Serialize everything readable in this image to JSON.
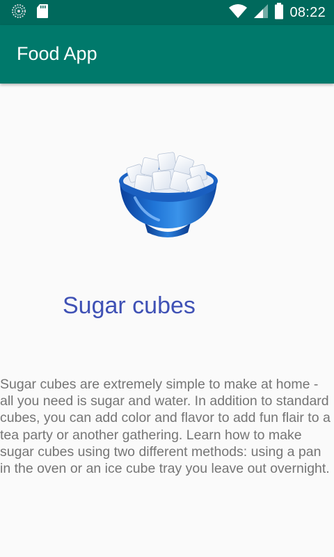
{
  "status_bar": {
    "time": "08:22",
    "icons": [
      "data-saver-icon",
      "sd-card-icon",
      "wifi-icon",
      "signal-icon",
      "battery-icon"
    ]
  },
  "app_bar": {
    "title": "Food App",
    "color": "#00796b",
    "status_color": "#00695c"
  },
  "food": {
    "image_icon": "sugar-bowl-icon",
    "title": "Sugar cubes",
    "title_color": "#3f51b5",
    "description": "Sugar cubes are extremely simple to make at home - all you need is sugar and water. In addition to standard cubes, you can add color and flavor to add fun flair to a tea party or another gathering. Learn how to make sugar cubes using two different methods: using a pan in the oven or an ice cube tray you leave out overnight."
  }
}
